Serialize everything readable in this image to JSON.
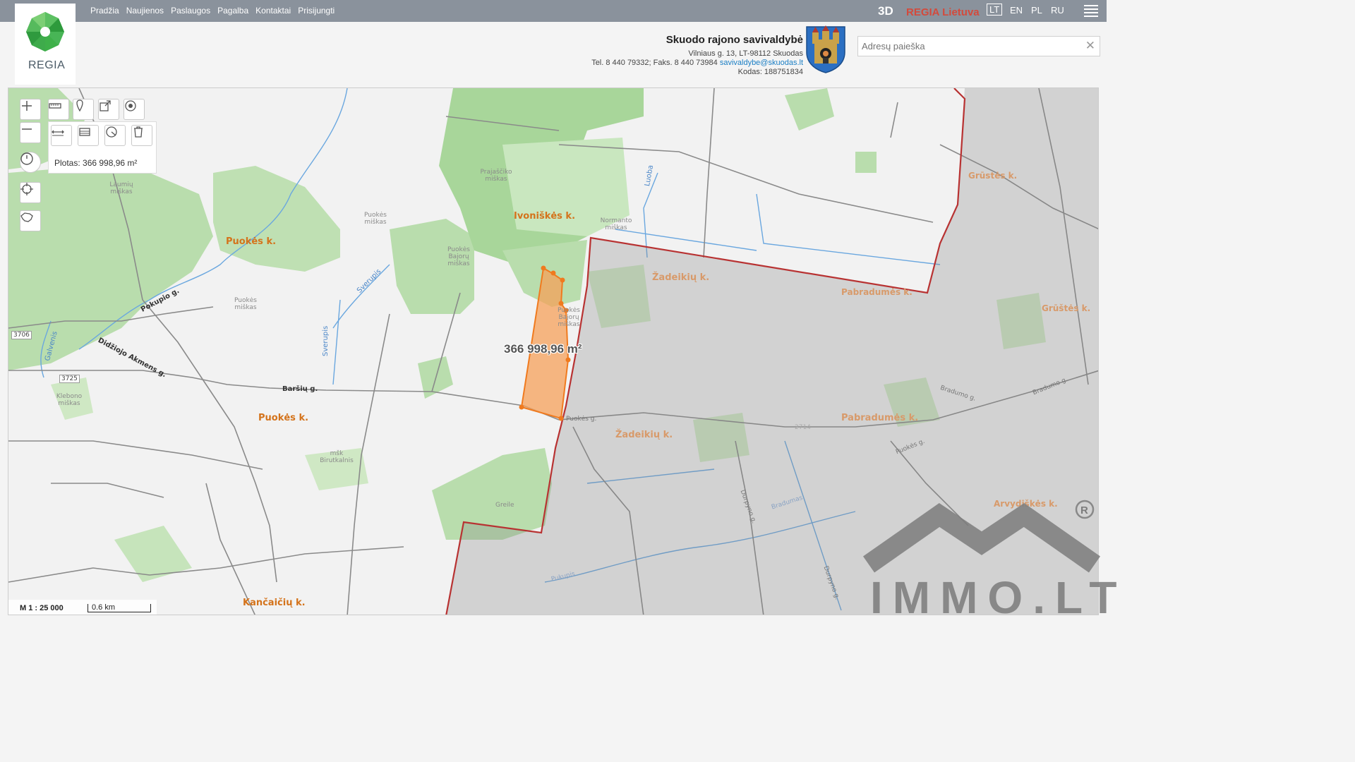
{
  "nav": {
    "items": [
      "Pradžia",
      "Naujienos",
      "Paslaugos",
      "Pagalba",
      "Kontaktai",
      "Prisijungti"
    ]
  },
  "topright": {
    "btn_3d": "3D",
    "regia_lietuva": "REGIA Lietuva",
    "languages": [
      "LT",
      "EN",
      "PL",
      "RU"
    ],
    "active_language": "LT"
  },
  "logo": {
    "text": "REGIA"
  },
  "municipality": {
    "name": "Skuodo rajono savivaldybė",
    "address": "Vilniaus g. 13, LT-98112 Skuodas",
    "phone": "Tel. 8 440 79332; Faks. 8 440 73984",
    "email": "savivaldybe@skuodas.lt",
    "code": "Kodas: 188751834"
  },
  "search": {
    "placeholder": "Adresų paieška",
    "value": ""
  },
  "map": {
    "area_info": "Plotas: 366 998,96 m²",
    "area_label": "366 998,96 m²",
    "scale": "M 1 : 25 000",
    "scale_bar": "0.6 km",
    "villages": [
      "Puokės k.",
      "Ivoniškės k.",
      "Žadeikių k.",
      "Pabradumės k.",
      "Grūstės k.",
      "Grūštės k.",
      "Puokės k.",
      "Žadeikių k.",
      "Pabradumės k.",
      "Kančaičių k.",
      "Arvydiškės k."
    ],
    "forests": [
      "Laumių miškas",
      "Puokės miškas",
      "Prajaščiko miškas",
      "Normanto miškas",
      "Puokės Bajorų miškas",
      "Puokės miškas",
      "Puokės Bajorų miškas",
      "Klebono miškas",
      "mšk Birutkalnis",
      "Greile"
    ],
    "streets": [
      "Pokupio g.",
      "Didžiojo Akmens g.",
      "Baršių g.",
      "Sverupis",
      "Sverupis",
      "Luoba",
      "Puokės g.",
      "Bradumo g.",
      "Bradumo g.",
      "Puokės g.",
      "Durpyno g.",
      "Durpyno g.",
      "Pukupis",
      "Bradumas",
      "Galvenis"
    ],
    "road_numbers": [
      "3706",
      "3725",
      "2714"
    ],
    "colors": {
      "forest": "#b9ddad",
      "forest_dark": "#a8d69a",
      "boundary": "#b83232",
      "parcel": "#f6a05a",
      "parcel_stroke": "#f07a1e",
      "water": "#6aa7df",
      "road": "#7c7c7c",
      "village_label": "#d4731b"
    }
  },
  "watermark": {
    "text": "IMMO.LT"
  }
}
